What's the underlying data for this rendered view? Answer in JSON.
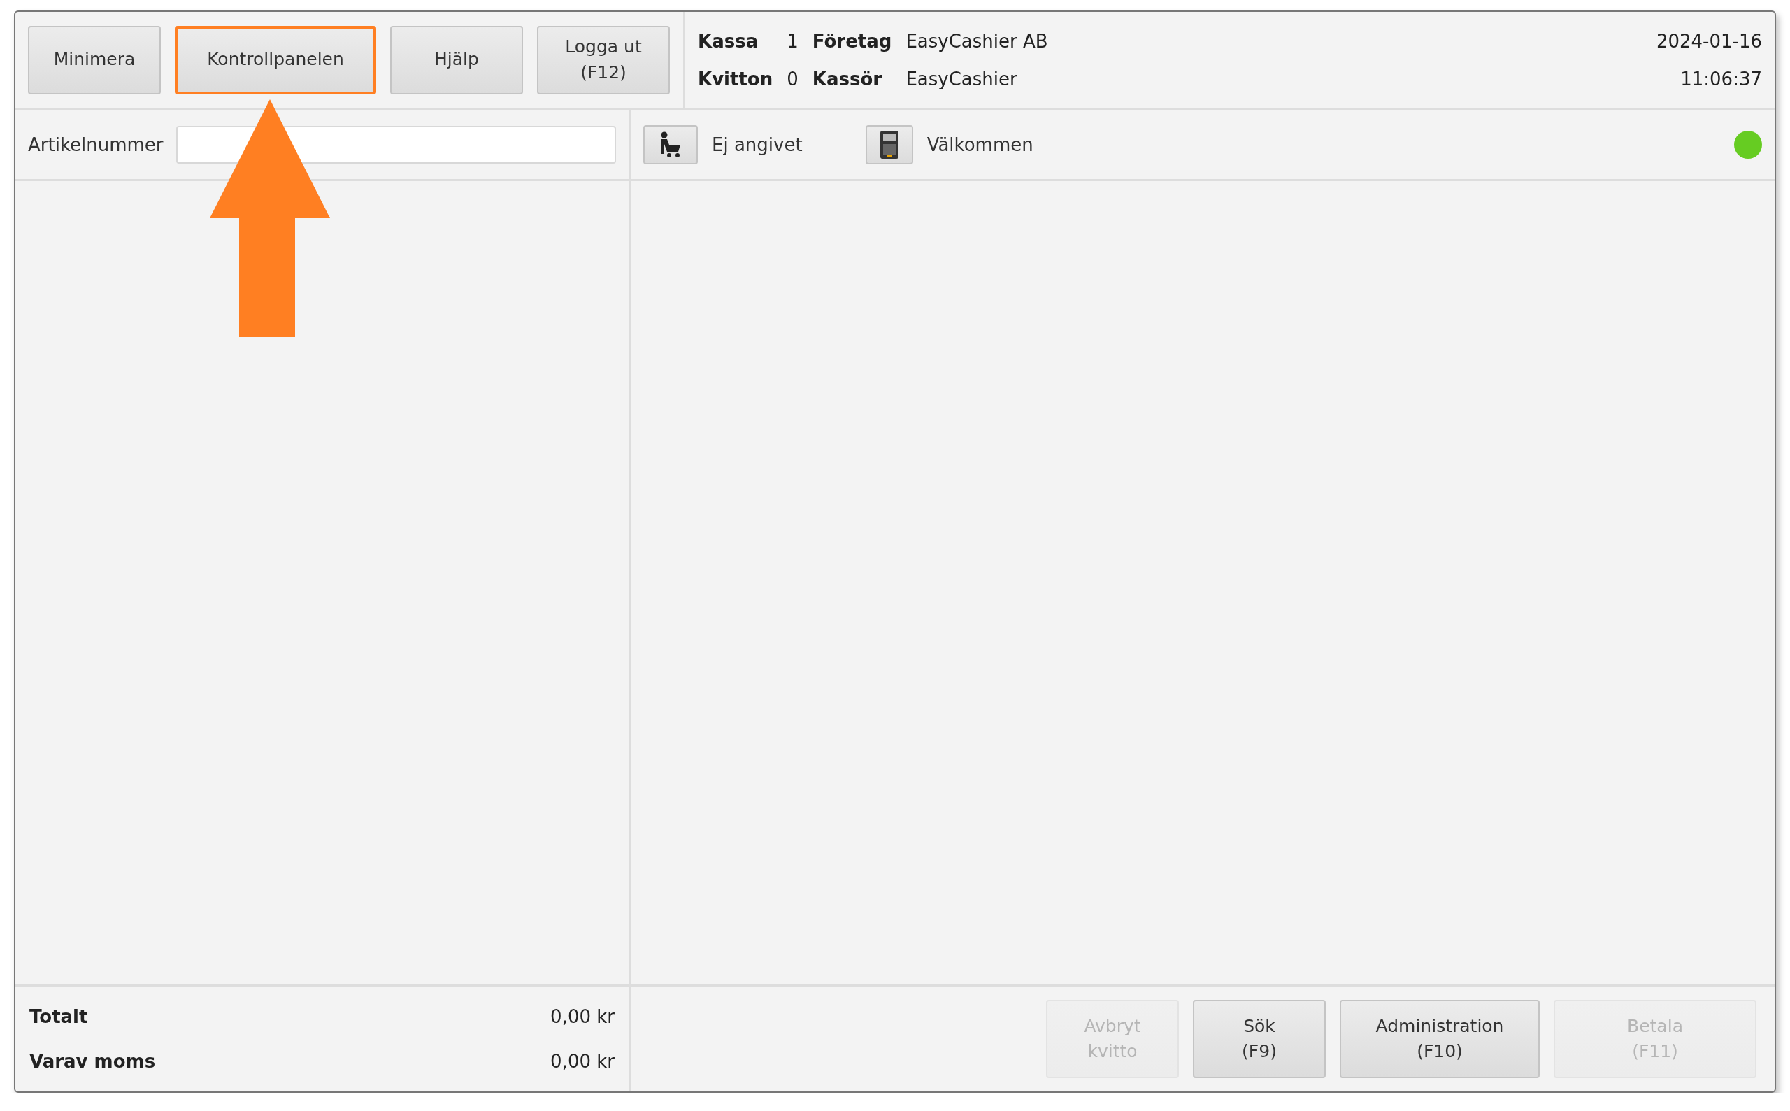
{
  "top_buttons": [
    {
      "label": "Minimera",
      "highlighted": false
    },
    {
      "label": "Kontrollpanelen",
      "highlighted": true
    },
    {
      "label": "Hjälp",
      "highlighted": false
    },
    {
      "label": "Logga ut\n(F12)",
      "highlighted": false
    }
  ],
  "info": {
    "kassa_label": "Kassa",
    "kassa_value": "1",
    "foretag_label": "Företag",
    "foretag_value": "EasyCashier AB",
    "kvitton_label": "Kvitton",
    "kvitton_value": "0",
    "kassor_label": "Kassör",
    "kassor_value": "EasyCashier",
    "date": "2024-01-16",
    "time": "11:06:37"
  },
  "article_field": {
    "label": "Artikelnummer"
  },
  "customer": {
    "text": "Ej angivet"
  },
  "terminal": {
    "text": "Välkommen"
  },
  "status": {
    "color": "#66cc22"
  },
  "totals": [
    {
      "label": "Totalt",
      "value": "0,00 kr"
    },
    {
      "label": "Varav moms",
      "value": "0,00 kr"
    }
  ],
  "bottom_buttons": [
    {
      "label": "Avbryt\nkvitto",
      "disabled": true
    },
    {
      "label": "Sök\n(F9)",
      "disabled": false
    },
    {
      "label": "Administration\n(F10)",
      "disabled": false
    },
    {
      "label": "Betala\n(F11)",
      "disabled": true
    }
  ],
  "annotation": {
    "kind": "arrow-up",
    "color": "#ff7f22"
  }
}
